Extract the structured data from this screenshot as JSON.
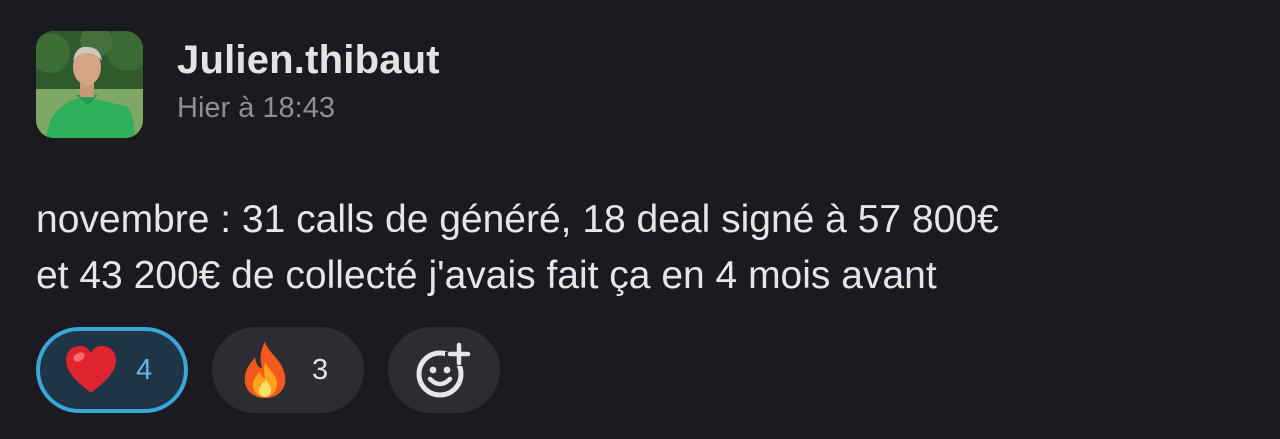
{
  "message": {
    "author": {
      "username": "Julien.thibaut",
      "avatar": "avatar-photo-man-green-shirt-golf-course"
    },
    "timestamp": "Hier à 18:43",
    "body_lines": [
      "novembre : 31 calls de généré,  18 deal signé à 57 800€",
      "et 43 200€ de collecté j'avais fait ça en 4 mois avant"
    ],
    "reactions": [
      {
        "emoji": "heart-icon",
        "count": "4",
        "selected": true,
        "color": "#3aa5d8"
      },
      {
        "emoji": "fire-icon",
        "count": "3",
        "selected": false
      }
    ],
    "add_reaction_icon": "add-reaction-icon"
  },
  "colors": {
    "background": "#1b1b1f",
    "pill": "#2c2d33",
    "selected_border": "#3aa5d8",
    "text": "#e6e6e9",
    "muted": "#8e8e94"
  }
}
